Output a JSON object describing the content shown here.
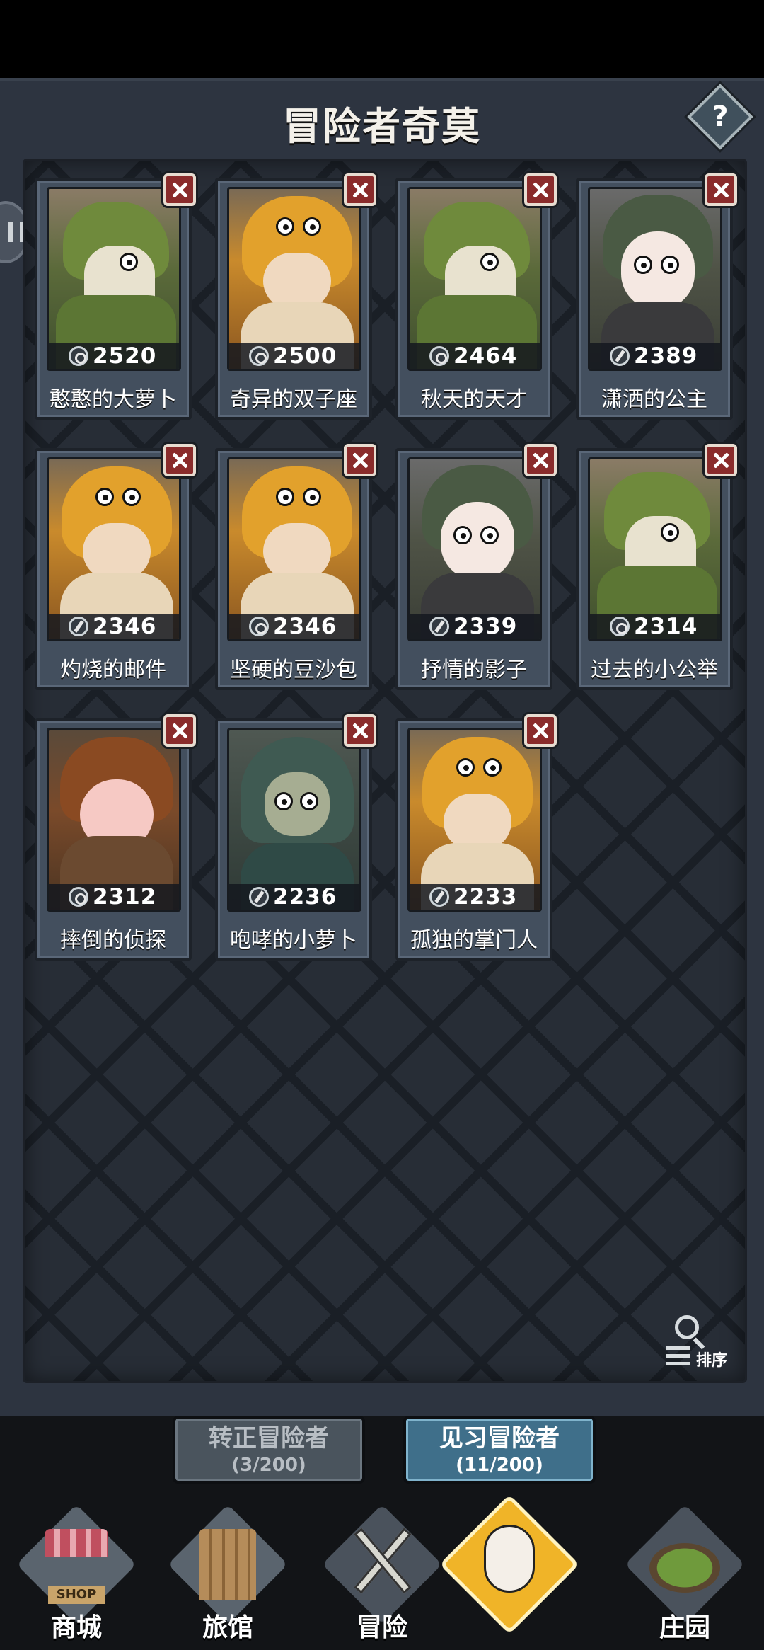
{
  "screen": {
    "title": "冒险者奇莫",
    "help_label": "?"
  },
  "cards": [
    {
      "name": "憨憨的大萝卜",
      "power": "2520",
      "power_icon": "target-icon",
      "portrait": "crocodile"
    },
    {
      "name": "奇异的双子座",
      "power": "2500",
      "power_icon": "target-icon",
      "portrait": "tiger"
    },
    {
      "name": "秋天的天才",
      "power": "2464",
      "power_icon": "target-icon",
      "portrait": "crocodile"
    },
    {
      "name": "潇洒的公主",
      "power": "2389",
      "power_icon": "pen-icon",
      "portrait": "sheep"
    },
    {
      "name": "灼烧的邮件",
      "power": "2346",
      "power_icon": "pen-icon",
      "portrait": "tiger"
    },
    {
      "name": "坚硬的豆沙包",
      "power": "2346",
      "power_icon": "target-icon",
      "portrait": "tiger"
    },
    {
      "name": "抒情的影子",
      "power": "2339",
      "power_icon": "pen-icon",
      "portrait": "sheep"
    },
    {
      "name": "过去的小公举",
      "power": "2314",
      "power_icon": "target-icon",
      "portrait": "crocodile"
    },
    {
      "name": "摔倒的侦探",
      "power": "2312",
      "power_icon": "target-icon",
      "portrait": "pumpkin"
    },
    {
      "name": "咆哮的小萝卜",
      "power": "2236",
      "power_icon": "pen-icon",
      "portrait": "hood"
    },
    {
      "name": "孤独的掌门人",
      "power": "2233",
      "power_icon": "pen-icon",
      "portrait": "tiger"
    }
  ],
  "sort": {
    "label": "排序"
  },
  "tabs": [
    {
      "label": "转正冒险者",
      "count": "(3/200)",
      "active": false
    },
    {
      "label": "见习冒险者",
      "count": "(11/200)",
      "active": true
    }
  ],
  "nav": {
    "shop": {
      "label": "商城",
      "sign": "SHOP"
    },
    "inn": {
      "label": "旅馆"
    },
    "adventure": {
      "label": "冒险"
    },
    "manor": {
      "label": "庄园"
    }
  },
  "colors": {
    "background": "#2d3440",
    "card": "#434f5e",
    "remove": "#8a2b2b",
    "active_tab": "#3f6f8a",
    "hero_highlight": "#f0b428"
  }
}
